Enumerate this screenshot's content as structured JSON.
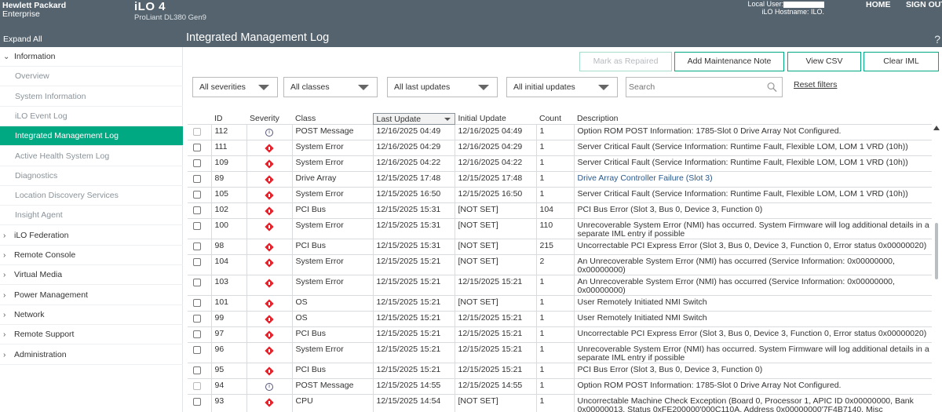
{
  "header": {
    "brand_line1": "Hewlett Packard",
    "brand_line2": "Enterprise",
    "product": "iLO 4",
    "server": "ProLiant DL380 Gen9",
    "local_user_label": "Local User:",
    "hostname_label": "iLO Hostname: ILO.",
    "home": "HOME",
    "signout": "SIGN OUT"
  },
  "title_band": {
    "expand_all": "Expand All",
    "page_title": "Integrated Management Log",
    "help": "?"
  },
  "sidebar": {
    "items": [
      {
        "label": "Information",
        "type": "parent",
        "expanded": true
      },
      {
        "label": "Overview",
        "type": "child"
      },
      {
        "label": "System Information",
        "type": "child"
      },
      {
        "label": "iLO Event Log",
        "type": "child"
      },
      {
        "label": "Integrated Management Log",
        "type": "child",
        "active": true
      },
      {
        "label": "Active Health System Log",
        "type": "child"
      },
      {
        "label": "Diagnostics",
        "type": "child"
      },
      {
        "label": "Location Discovery Services",
        "type": "child"
      },
      {
        "label": "Insight Agent",
        "type": "child"
      },
      {
        "label": "iLO Federation",
        "type": "parent"
      },
      {
        "label": "Remote Console",
        "type": "parent"
      },
      {
        "label": "Virtual Media",
        "type": "parent"
      },
      {
        "label": "Power Management",
        "type": "parent"
      },
      {
        "label": "Network",
        "type": "parent"
      },
      {
        "label": "Remote Support",
        "type": "parent"
      },
      {
        "label": "Administration",
        "type": "parent"
      }
    ]
  },
  "toolbar": {
    "mark_repaired": "Mark as Repaired",
    "add_note": "Add Maintenance Note",
    "view_csv": "View CSV",
    "clear_iml": "Clear IML"
  },
  "filters": {
    "severities": "All severities",
    "classes": "All classes",
    "last_updates": "All last updates",
    "initial_updates": "All initial updates",
    "search_placeholder": "Search",
    "reset": "Reset filters"
  },
  "table": {
    "headers": {
      "id": "ID",
      "severity": "Severity",
      "class": "Class",
      "last_update": "Last Update",
      "initial_update": "Initial Update",
      "count": "Count",
      "description": "Description"
    },
    "rows": [
      {
        "id": "112",
        "sev": "info",
        "class": "POST Message",
        "last": "12/16/2025 04:49",
        "initial": "12/16/2025 04:49",
        "count": "1",
        "desc": "Option ROM POST Information: 1785-Slot 0 Drive Array Not Configured.",
        "h": 1
      },
      {
        "id": "111",
        "sev": "critical",
        "class": "System Error",
        "last": "12/16/2025 04:29",
        "initial": "12/16/2025 04:29",
        "count": "1",
        "desc": "Server Critical Fault (Service Information: Runtime Fault, Flexible LOM,  LOM 1 VRD (10h))",
        "h": 1
      },
      {
        "id": "109",
        "sev": "critical",
        "class": "System Error",
        "last": "12/16/2025 04:22",
        "initial": "12/16/2025 04:22",
        "count": "1",
        "desc": "Server Critical Fault (Service Information: Runtime Fault, Flexible LOM,  LOM 1 VRD (10h))",
        "h": 1
      },
      {
        "id": "89",
        "sev": "critical",
        "class": "Drive Array",
        "last": "12/15/2025 17:48",
        "initial": "12/15/2025 17:48",
        "count": "1",
        "desc": "Drive Array Controller Failure (Slot 3)",
        "h": 1,
        "link": true
      },
      {
        "id": "105",
        "sev": "critical",
        "class": "System Error",
        "last": "12/15/2025 16:50",
        "initial": "12/15/2025 16:50",
        "count": "1",
        "desc": "Server Critical Fault (Service Information: Runtime Fault, Flexible LOM,  LOM 1 VRD (10h))",
        "h": 1
      },
      {
        "id": "102",
        "sev": "critical",
        "class": "PCI Bus",
        "last": "12/15/2025 15:31",
        "initial": "[NOT SET]",
        "count": "104",
        "desc": "PCI Bus Error (Slot 3, Bus 0, Device 3, Function 0)",
        "h": 1
      },
      {
        "id": "100",
        "sev": "critical",
        "class": "System Error",
        "last": "12/15/2025 15:31",
        "initial": "[NOT SET]",
        "count": "110",
        "desc": "Unrecoverable System Error (NMI) has occurred.  System Firmware will log additional details in a separate IML entry if possible",
        "h": 2
      },
      {
        "id": "98",
        "sev": "critical",
        "class": "PCI Bus",
        "last": "12/15/2025 15:31",
        "initial": "[NOT SET]",
        "count": "215",
        "desc": "Uncorrectable PCI Express Error (Slot 3, Bus 0, Device 3, Function 0, Error status 0x00000020)",
        "h": 1
      },
      {
        "id": "104",
        "sev": "critical",
        "class": "System Error",
        "last": "12/15/2025 15:21",
        "initial": "[NOT SET]",
        "count": "2",
        "desc": "An Unrecoverable System Error (NMI) has occurred (Service Information: 0x00000000, 0x00000000)",
        "h": 2
      },
      {
        "id": "103",
        "sev": "critical",
        "class": "System Error",
        "last": "12/15/2025 15:21",
        "initial": "12/15/2025 15:21",
        "count": "1",
        "desc": "An Unrecoverable System Error (NMI) has occurred (Service Information: 0x00000000, 0x00000000)",
        "h": 2
      },
      {
        "id": "101",
        "sev": "critical",
        "class": "OS",
        "last": "12/15/2025 15:21",
        "initial": "[NOT SET]",
        "count": "1",
        "desc": "User Remotely Initiated NMI Switch",
        "h": 1
      },
      {
        "id": "99",
        "sev": "critical",
        "class": "OS",
        "last": "12/15/2025 15:21",
        "initial": "12/15/2025 15:21",
        "count": "1",
        "desc": "User Remotely Initiated NMI Switch",
        "h": 1
      },
      {
        "id": "97",
        "sev": "critical",
        "class": "PCI Bus",
        "last": "12/15/2025 15:21",
        "initial": "12/15/2025 15:21",
        "count": "1",
        "desc": "Uncorrectable PCI Express Error (Slot 3, Bus 0, Device 3, Function 0, Error status 0x00000020)",
        "h": 1
      },
      {
        "id": "96",
        "sev": "critical",
        "class": "System Error",
        "last": "12/15/2025 15:21",
        "initial": "12/15/2025 15:21",
        "count": "1",
        "desc": "Unrecoverable System Error (NMI) has occurred.  System Firmware will log additional details in a separate IML entry if possible",
        "h": 2
      },
      {
        "id": "95",
        "sev": "critical",
        "class": "PCI Bus",
        "last": "12/15/2025 15:21",
        "initial": "12/15/2025 15:21",
        "count": "1",
        "desc": "PCI Bus Error (Slot 3, Bus 0, Device 3, Function 0)",
        "h": 1
      },
      {
        "id": "94",
        "sev": "info",
        "class": "POST Message",
        "last": "12/15/2025 14:55",
        "initial": "12/15/2025 14:55",
        "count": "1",
        "desc": "Option ROM POST Information: 1785-Slot 0 Drive Array Not Configured.",
        "h": 1
      },
      {
        "id": "93",
        "sev": "critical",
        "class": "CPU",
        "last": "12/15/2025 14:54",
        "initial": "[NOT SET]",
        "count": "1",
        "desc": "Uncorrectable Machine Check Exception (Board 0, Processor 1, APIC ID 0x00000000, Bank 0x00000013, Status 0xFE200000'000C110A, Address 0x00000000'7F4B7140, Misc 0xF4FFF016'11100086)",
        "h": 3
      }
    ]
  },
  "colors": {
    "header_bg": "#54636e",
    "accent": "#01a982",
    "critical": "#e8222c"
  }
}
